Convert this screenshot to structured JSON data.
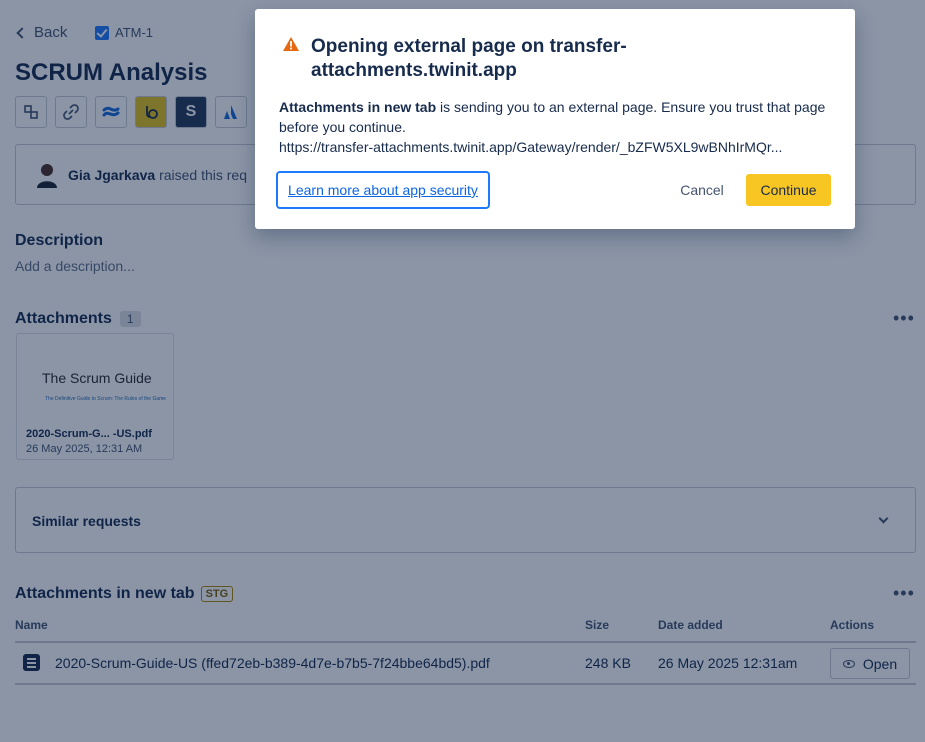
{
  "header": {
    "back_label": "Back",
    "issue_key": "ATM-1",
    "title": "SCRUM Analysis"
  },
  "toolbar": {
    "icons": [
      "hierarchy-icon",
      "link-icon",
      "confluence-icon",
      "app-icon",
      "s-app-icon",
      "atlassian-icon"
    ]
  },
  "request": {
    "raiser_name": "Gia Jgarkava",
    "raised_text": "raised this req"
  },
  "description": {
    "heading": "Description",
    "placeholder": "Add a description..."
  },
  "attachments": {
    "heading": "Attachments",
    "count": "1",
    "more": "•••",
    "items": [
      {
        "thumb_title": "The Scrum Guide",
        "thumb_subtitle": "The Definitive Guide to Scrum: The Rules of the Game",
        "name": "2020-Scrum-G... -US.pdf",
        "date": "26 May 2025, 12:31 AM"
      }
    ]
  },
  "similar": {
    "label": "Similar requests"
  },
  "attachments_new_tab": {
    "heading": "Attachments in new tab",
    "badge": "STG",
    "more": "•••",
    "columns": [
      "Name",
      "Size",
      "Date added",
      "Actions"
    ],
    "rows": [
      {
        "name": "2020-Scrum-Guide-US (ffed72eb-b389-4d7e-b7b5-7f24bbe64bd5).pdf",
        "size": "248 KB",
        "date": "26 May 2025 12:31am",
        "action": "Open"
      }
    ]
  },
  "modal": {
    "title": "Opening external page on transfer-attachments.twinit.app",
    "body_bold": "Attachments in new tab",
    "body_rest": " is sending you to an external page. Ensure you trust that page before you continue.",
    "url": "https://transfer-attachments.twinit.app/Gateway/render/_bZFW5XL9wBNhIrMQr...",
    "link_label": "Learn more about app security",
    "cancel_label": "Cancel",
    "continue_label": "Continue"
  },
  "colors": {
    "overlay": "#091e42",
    "primary_button": "#f8c623",
    "link": "#0c66e4",
    "warning": "#e56910"
  }
}
